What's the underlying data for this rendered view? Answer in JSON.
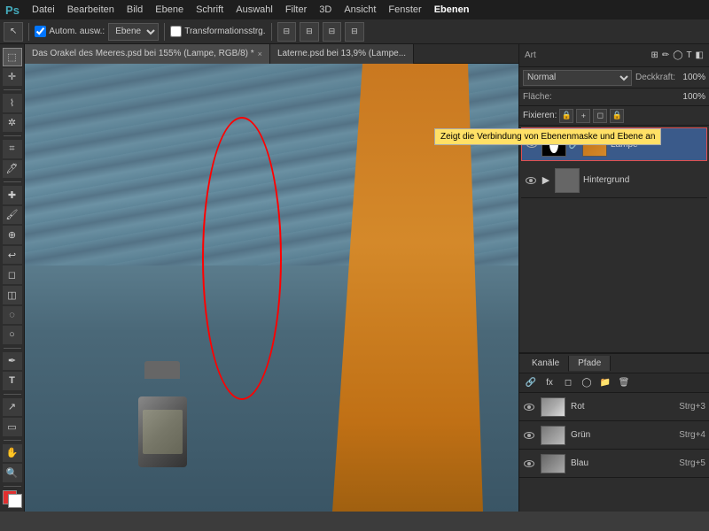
{
  "app": {
    "title": "Adobe Photoshop"
  },
  "menubar": {
    "logo": "Ps",
    "items": [
      "Datei",
      "Bearbeiten",
      "Bild",
      "Ebene",
      "Schrift",
      "Auswahl",
      "Filter",
      "3D",
      "Ansicht",
      "Fenster",
      "Ebenen"
    ]
  },
  "toolbar": {
    "move_tool": "↖",
    "auto_select_label": "Autom. ausw.:",
    "layer_dropdown": "Ebene",
    "transform_label": "Transformationsstrg.",
    "align_icons": [
      "⊟",
      "⊟",
      "⊟",
      "⊟"
    ]
  },
  "tabs": {
    "tab1": {
      "label": "Das Orakel des Meeres.psd bei 155% (Lampe, RGB/8) *"
    },
    "tab2": {
      "label": "Laterne.psd bei 13,9% (Lampe..."
    }
  },
  "layers_panel": {
    "search_placeholder": "Art",
    "blend_mode": "Normal",
    "opacity_label": "Deckkraft:",
    "opacity_value": "100%",
    "fill_label": "Fläche:",
    "fill_value": "100%",
    "fixieren_label": "Fixieren:",
    "fix_icons": [
      "🔒",
      "✦",
      "⬤",
      "🔒"
    ],
    "layers": [
      {
        "name": "Lampe",
        "has_mask": true,
        "active": true
      },
      {
        "name": "Hintergrund",
        "has_mask": false,
        "active": false
      }
    ]
  },
  "tooltip": {
    "text": "Zeigt die Verbindung von Ebenenmaske und Ebene an"
  },
  "channels_panel": {
    "tabs": [
      "Kanäle",
      "Pfade"
    ],
    "active_tab": "Kanäle",
    "channels": [
      {
        "name": "Rot",
        "shortcut": "Strg+3"
      },
      {
        "name": "Grün",
        "shortcut": "Strg+4"
      },
      {
        "name": "Blau",
        "shortcut": "Strg+5"
      }
    ]
  }
}
